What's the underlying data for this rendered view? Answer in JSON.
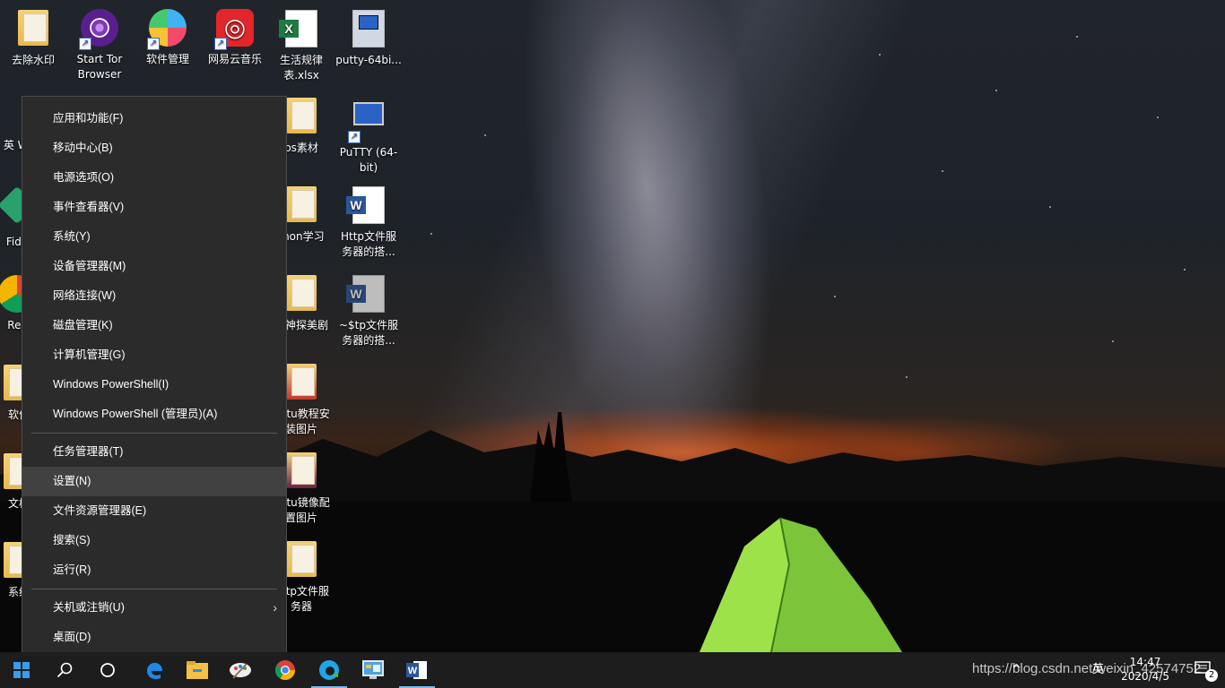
{
  "desktop_icons": [
    {
      "label": "去除水印",
      "icon": "folder-icon"
    },
    {
      "label": "Start Tor Browser",
      "icon": "tor-browser-icon"
    },
    {
      "label": "软件管理",
      "icon": "software-manager-icon"
    },
    {
      "label": "网易云音乐",
      "icon": "netease-music-icon"
    },
    {
      "label": "生活规律表.xlsx",
      "icon": "excel-file-icon"
    },
    {
      "label": "putty-64bi...",
      "icon": "putty-installer-icon"
    },
    {
      "label": "英 We",
      "icon": "app-icon"
    },
    {
      "label": "ps素材",
      "icon": "folder-icon"
    },
    {
      "label": "PuTTY (64-bit)",
      "icon": "putty-icon"
    },
    {
      "label": "Fido",
      "icon": "app-icon"
    },
    {
      "label": "thon学习",
      "icon": "folder-icon"
    },
    {
      "label": "Http文件服务器的搭...",
      "icon": "word-file-icon"
    },
    {
      "label": "Res",
      "icon": "app-icon"
    },
    {
      "label": "亿神探美剧",
      "icon": "folder-icon"
    },
    {
      "label": "~$tp文件服务器的搭...",
      "icon": "word-temp-file-icon"
    },
    {
      "label": "软件",
      "icon": "folder-icon"
    },
    {
      "label": "untu教程安装图片",
      "icon": "folder-icon"
    },
    {
      "label": "文档",
      "icon": "folder-icon"
    },
    {
      "label": "untu镜像配置图片",
      "icon": "folder-icon"
    },
    {
      "label": "系统",
      "icon": "folder-icon"
    },
    {
      "label": "Http文件服务器",
      "icon": "folder-icon"
    }
  ],
  "context_menu": {
    "group1": [
      "应用和功能(F)",
      "移动中心(B)",
      "电源选项(O)",
      "事件查看器(V)",
      "系统(Y)",
      "设备管理器(M)",
      "网络连接(W)",
      "磁盘管理(K)",
      "计算机管理(G)",
      "Windows PowerShell(I)",
      "Windows PowerShell (管理员)(A)"
    ],
    "group2": [
      "任务管理器(T)",
      "设置(N)",
      "文件资源管理器(E)",
      "搜索(S)",
      "运行(R)"
    ],
    "group3": [
      "关机或注销(U)",
      "桌面(D)"
    ],
    "highlighted": "设置(N)",
    "submenu_arrow": "›"
  },
  "taskbar": {
    "items": [
      "start-icon",
      "search-icon",
      "task-view-icon",
      "edge-icon",
      "file-explorer-icon",
      "paint-icon",
      "chrome-icon",
      "edge-chromium-icon",
      "control-panel-icon",
      "word-icon"
    ],
    "tray": {
      "chevron": "^",
      "ime": "英",
      "time": "14:47",
      "date": "2020/4/5",
      "notifications": "2"
    }
  },
  "watermark": "https://blog.csdn.net/weixin_42574752",
  "colors": {
    "menu_bg": "#2b2b2b",
    "menu_hl": "#414141",
    "taskbar_bg": "#1d1d1d",
    "accent": "#76b9ed"
  }
}
